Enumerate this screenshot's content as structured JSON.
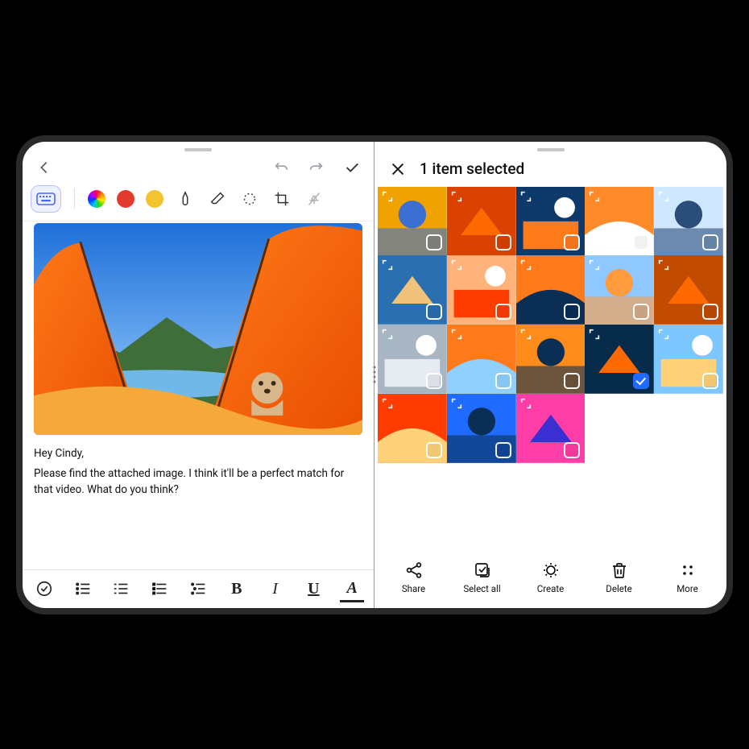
{
  "left": {
    "toolbar": {
      "back": "back",
      "undo": "undo",
      "redo": "redo",
      "confirm": "confirm"
    },
    "tools": {
      "keyboard": "keyboard",
      "color_palette": "color-palette",
      "color_red": "#e23b2e",
      "color_yellow": "#f4c430",
      "pen": "pen",
      "eraser": "eraser",
      "lasso": "lasso-select",
      "crop": "crop",
      "no_pen": "disable-input"
    },
    "note": {
      "greeting": "Hey Cindy,",
      "body": "Please find the attached image. I think it'll be a perfect match for that video. What do you think?"
    },
    "format": {
      "checklist": "checklist",
      "list_num": "numbered-list",
      "list_dot": "bulleted-list",
      "list_line": "lined-list",
      "list_indent": "indent-list",
      "bold": "B",
      "italic": "I",
      "underline": "U",
      "highlight": "A"
    }
  },
  "right": {
    "header": {
      "close": "close",
      "title": "1 item selected"
    },
    "thumbs_count": 18,
    "selected_index": 13,
    "actions": {
      "share": "Share",
      "select_all": "Select all",
      "create": "Create",
      "delete": "Delete",
      "more": "More"
    }
  }
}
